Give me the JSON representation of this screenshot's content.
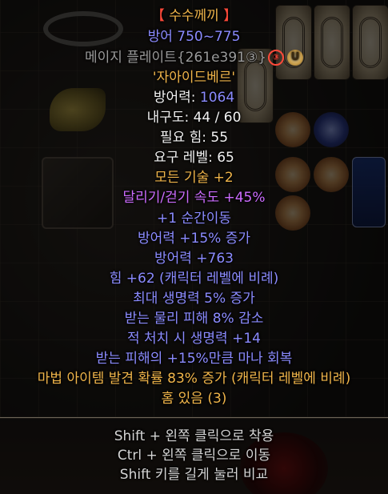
{
  "item": {
    "name_bracket_left": "【",
    "name": " 수수께끼 ",
    "name_bracket_right": "】",
    "base_defense_range": "방어 750~775",
    "base_type_text": "메이지 플레이트{261e391③}",
    "socket_count_badge": "③",
    "unique_badge": "U",
    "runeword_label": "'자아이드베르'",
    "defense": "방어력: 1064",
    "durability": "내구도: 44 / 60",
    "required_strength": "필요 힘: 55",
    "required_level": "요구 레벨: 65",
    "all_skills": "모든 기술 +2",
    "run_walk": "달리기/걷기 속도 +45%",
    "mods": [
      "+1 순간이동",
      "방어력 +15% 증가",
      "방어력 +763",
      "힘 +62 (캐릭터 레벨에 비례)",
      "최대 생명력 5% 증가",
      "받는 물리 피해 8% 감소",
      "적 처치 시 생명력 +14",
      "받는 피해의 +15%만큼 마나 회복",
      "마법 아이템 발견 확률 83% 증가 (캐릭터 레벨에 비례)",
      "홈 있음 (3)"
    ]
  },
  "hints": [
    "Shift + 왼쪽 클릭으로 착용",
    "Ctrl + 왼쪽 클릭으로 이동",
    "Shift 키를 길게 눌러 비교"
  ],
  "colors": {
    "title_gold": "#f0b54a",
    "bracket_red": "#ff4a3a",
    "mod_blue": "#8b8bff",
    "stat_white": "#f2f2f2",
    "purple": "#cc6cff",
    "base_gray": "#9a9a9a"
  }
}
